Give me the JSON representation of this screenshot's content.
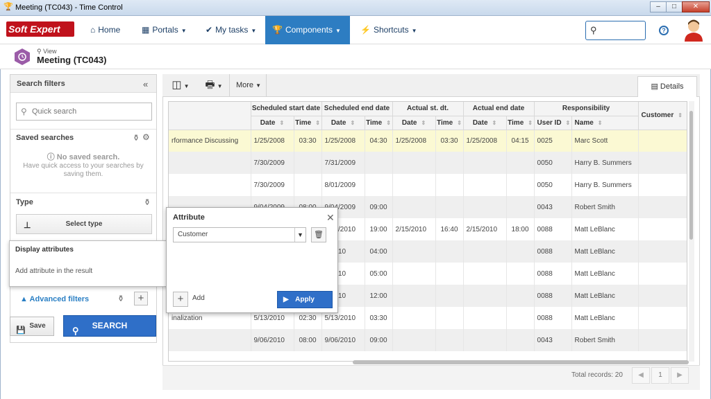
{
  "window": {
    "title": "Meeting (TC043) - Time Control"
  },
  "nav": {
    "logo": "Soft Expert",
    "items": [
      {
        "label": "Home"
      },
      {
        "label": "Portals"
      },
      {
        "label": "My tasks"
      },
      {
        "label": "Components",
        "active": true
      },
      {
        "label": "Shortcuts"
      }
    ],
    "help": "?"
  },
  "view": {
    "label": "View",
    "title": "Meeting (TC043)"
  },
  "left": {
    "header": "Search filters",
    "quick_search_placeholder": "Quick search",
    "saved_searches": "Saved searches",
    "no_saved": "No saved search.",
    "no_saved_desc": "Have quick access to your searches by saving them.",
    "type_label": "Type",
    "select_type": "Select type",
    "advanced_filters": "Advanced filters",
    "save": "Save",
    "search": "SEARCH"
  },
  "toolbar": {
    "more": "More",
    "details": "Details"
  },
  "display_attributes": {
    "title": "Display attributes",
    "desc": "Add attribute in the result"
  },
  "attribute_popup": {
    "title": "Attribute",
    "selected": "Customer",
    "add": "Add",
    "apply": "Apply"
  },
  "grid": {
    "groups": [
      "Scheduled start date",
      "Scheduled end date",
      "Actual st. dt.",
      "Actual end date",
      "Responsibility",
      "Customer"
    ],
    "subheaders": [
      "Date",
      "Time",
      "Date",
      "Time",
      "Date",
      "Time",
      "Date",
      "Time",
      "User ID",
      "Name"
    ],
    "rows": [
      [
        "rformance Discussing",
        "1/25/2008",
        "03:30",
        "1/25/2008",
        "04:30",
        "1/25/2008",
        "03:30",
        "1/25/2008",
        "04:15",
        "0025",
        "Marc Scott",
        ""
      ],
      [
        "",
        "7/30/2009",
        "",
        "7/31/2009",
        "",
        "",
        "",
        "",
        "",
        "0050",
        "Harry B. Summers",
        ""
      ],
      [
        "",
        "7/30/2009",
        "",
        "8/01/2009",
        "",
        "",
        "",
        "",
        "",
        "0050",
        "Harry B. Summers",
        ""
      ],
      [
        "",
        "9/04/2009",
        "08:00",
        "9/04/2009",
        "09:00",
        "",
        "",
        "",
        "",
        "0043",
        "Robert Smith",
        ""
      ],
      [
        "",
        "",
        "",
        "2/15/2010",
        "19:00",
        "2/15/2010",
        "16:40",
        "2/15/2010",
        "18:00",
        "0088",
        "Matt LeBlanc",
        ""
      ],
      [
        "",
        "",
        "",
        "5/2010",
        "04:00",
        "",
        "",
        "",
        "",
        "0088",
        "Matt LeBlanc",
        ""
      ],
      [
        "",
        "",
        "",
        "7/2010",
        "05:00",
        "",
        "",
        "",
        "",
        "0088",
        "Matt LeBlanc",
        ""
      ],
      [
        "",
        "",
        "",
        "2/2010",
        "12:00",
        "",
        "",
        "",
        "",
        "0088",
        "Matt LeBlanc",
        ""
      ],
      [
        "inalization",
        "5/13/2010",
        "02:30",
        "5/13/2010",
        "03:30",
        "",
        "",
        "",
        "",
        "0088",
        "Matt LeBlanc",
        ""
      ],
      [
        "",
        "9/06/2010",
        "08:00",
        "9/06/2010",
        "09:00",
        "",
        "",
        "",
        "",
        "0043",
        "Robert Smith",
        ""
      ]
    ]
  },
  "footer": {
    "total_records": "Total records: 20",
    "page": "1"
  }
}
